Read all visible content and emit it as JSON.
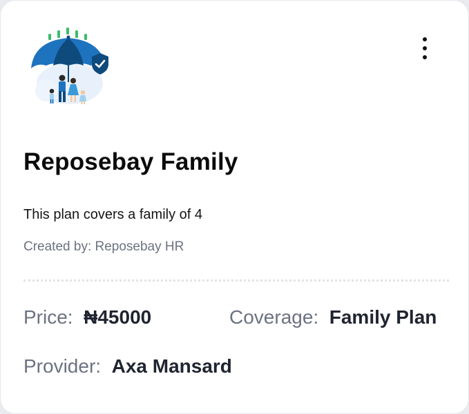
{
  "card": {
    "icons": {
      "illustration": "family-umbrella-shield-illustration",
      "menu": "kebab-menu-icon"
    },
    "title": "Reposebay Family",
    "description": "This plan covers a family of 4",
    "created_by": "Created by: Reposebay HR",
    "details": {
      "price": {
        "label": "Price:",
        "value": "₦45000"
      },
      "coverage": {
        "label": "Coverage:",
        "value": "Family Plan"
      },
      "provider": {
        "label": "Provider:",
        "value": "Axa Mansard"
      }
    },
    "colors": {
      "umbrella_blue": "#1e73be",
      "umbrella_dark": "#0f4a7d",
      "accent_green": "#3dbb6a",
      "muted_text": "#6b7280"
    }
  }
}
